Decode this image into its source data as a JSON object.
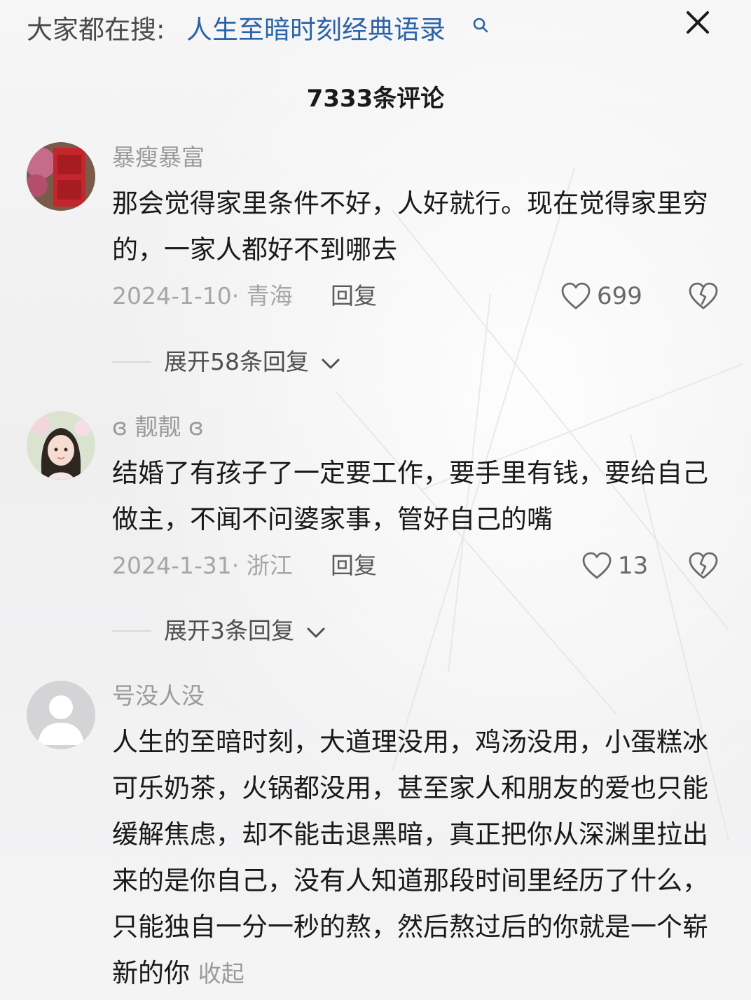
{
  "header": {
    "hot_prefix": "大家都在搜:",
    "hot_query": "人生至暗时刻经典语录",
    "search_icon": "search-icon",
    "close_icon": "close-icon"
  },
  "comments_title": "7333条评论",
  "comments": [
    {
      "username": "暴瘦暴富",
      "text": "那会觉得家里条件不好，人好就行。现在觉得家里穷的，一家人都好不到哪去",
      "date_location": "2024-1-10· 青海",
      "reply_label": "回复",
      "likes": "699",
      "expand_label": "展开58条回复"
    },
    {
      "username": "ɞ 靓靓 ɞ",
      "text": "结婚了有孩子了一定要工作，要手里有钱，要给自己做主，不闻不问婆家事，管好自己的嘴",
      "date_location": "2024-1-31· 浙江",
      "reply_label": "回复",
      "likes": "13",
      "expand_label": "展开3条回复"
    },
    {
      "username": "号没人没",
      "text": "人生的至暗时刻，大道理没用，鸡汤没用，小蛋糕冰可乐奶茶，火锅都没用，甚至家人和朋友的爱也只能缓解焦虑，却不能击退黑暗，真正把你从深渊里拉出来的是你自己，没有人知道那段时间里经历了什么，只能独自一分一秒的熬，然后熬过后的你就是一个崭新的你",
      "collapse_label": "收起"
    }
  ],
  "icons": [
    "heart-icon",
    "heart-broken-icon",
    "chevron-down-icon",
    "default-avatar-icon"
  ],
  "colors": {
    "link_blue": "#2c63a8",
    "meta_gray": "#a6a6a6",
    "background": "#f3f3f4"
  }
}
